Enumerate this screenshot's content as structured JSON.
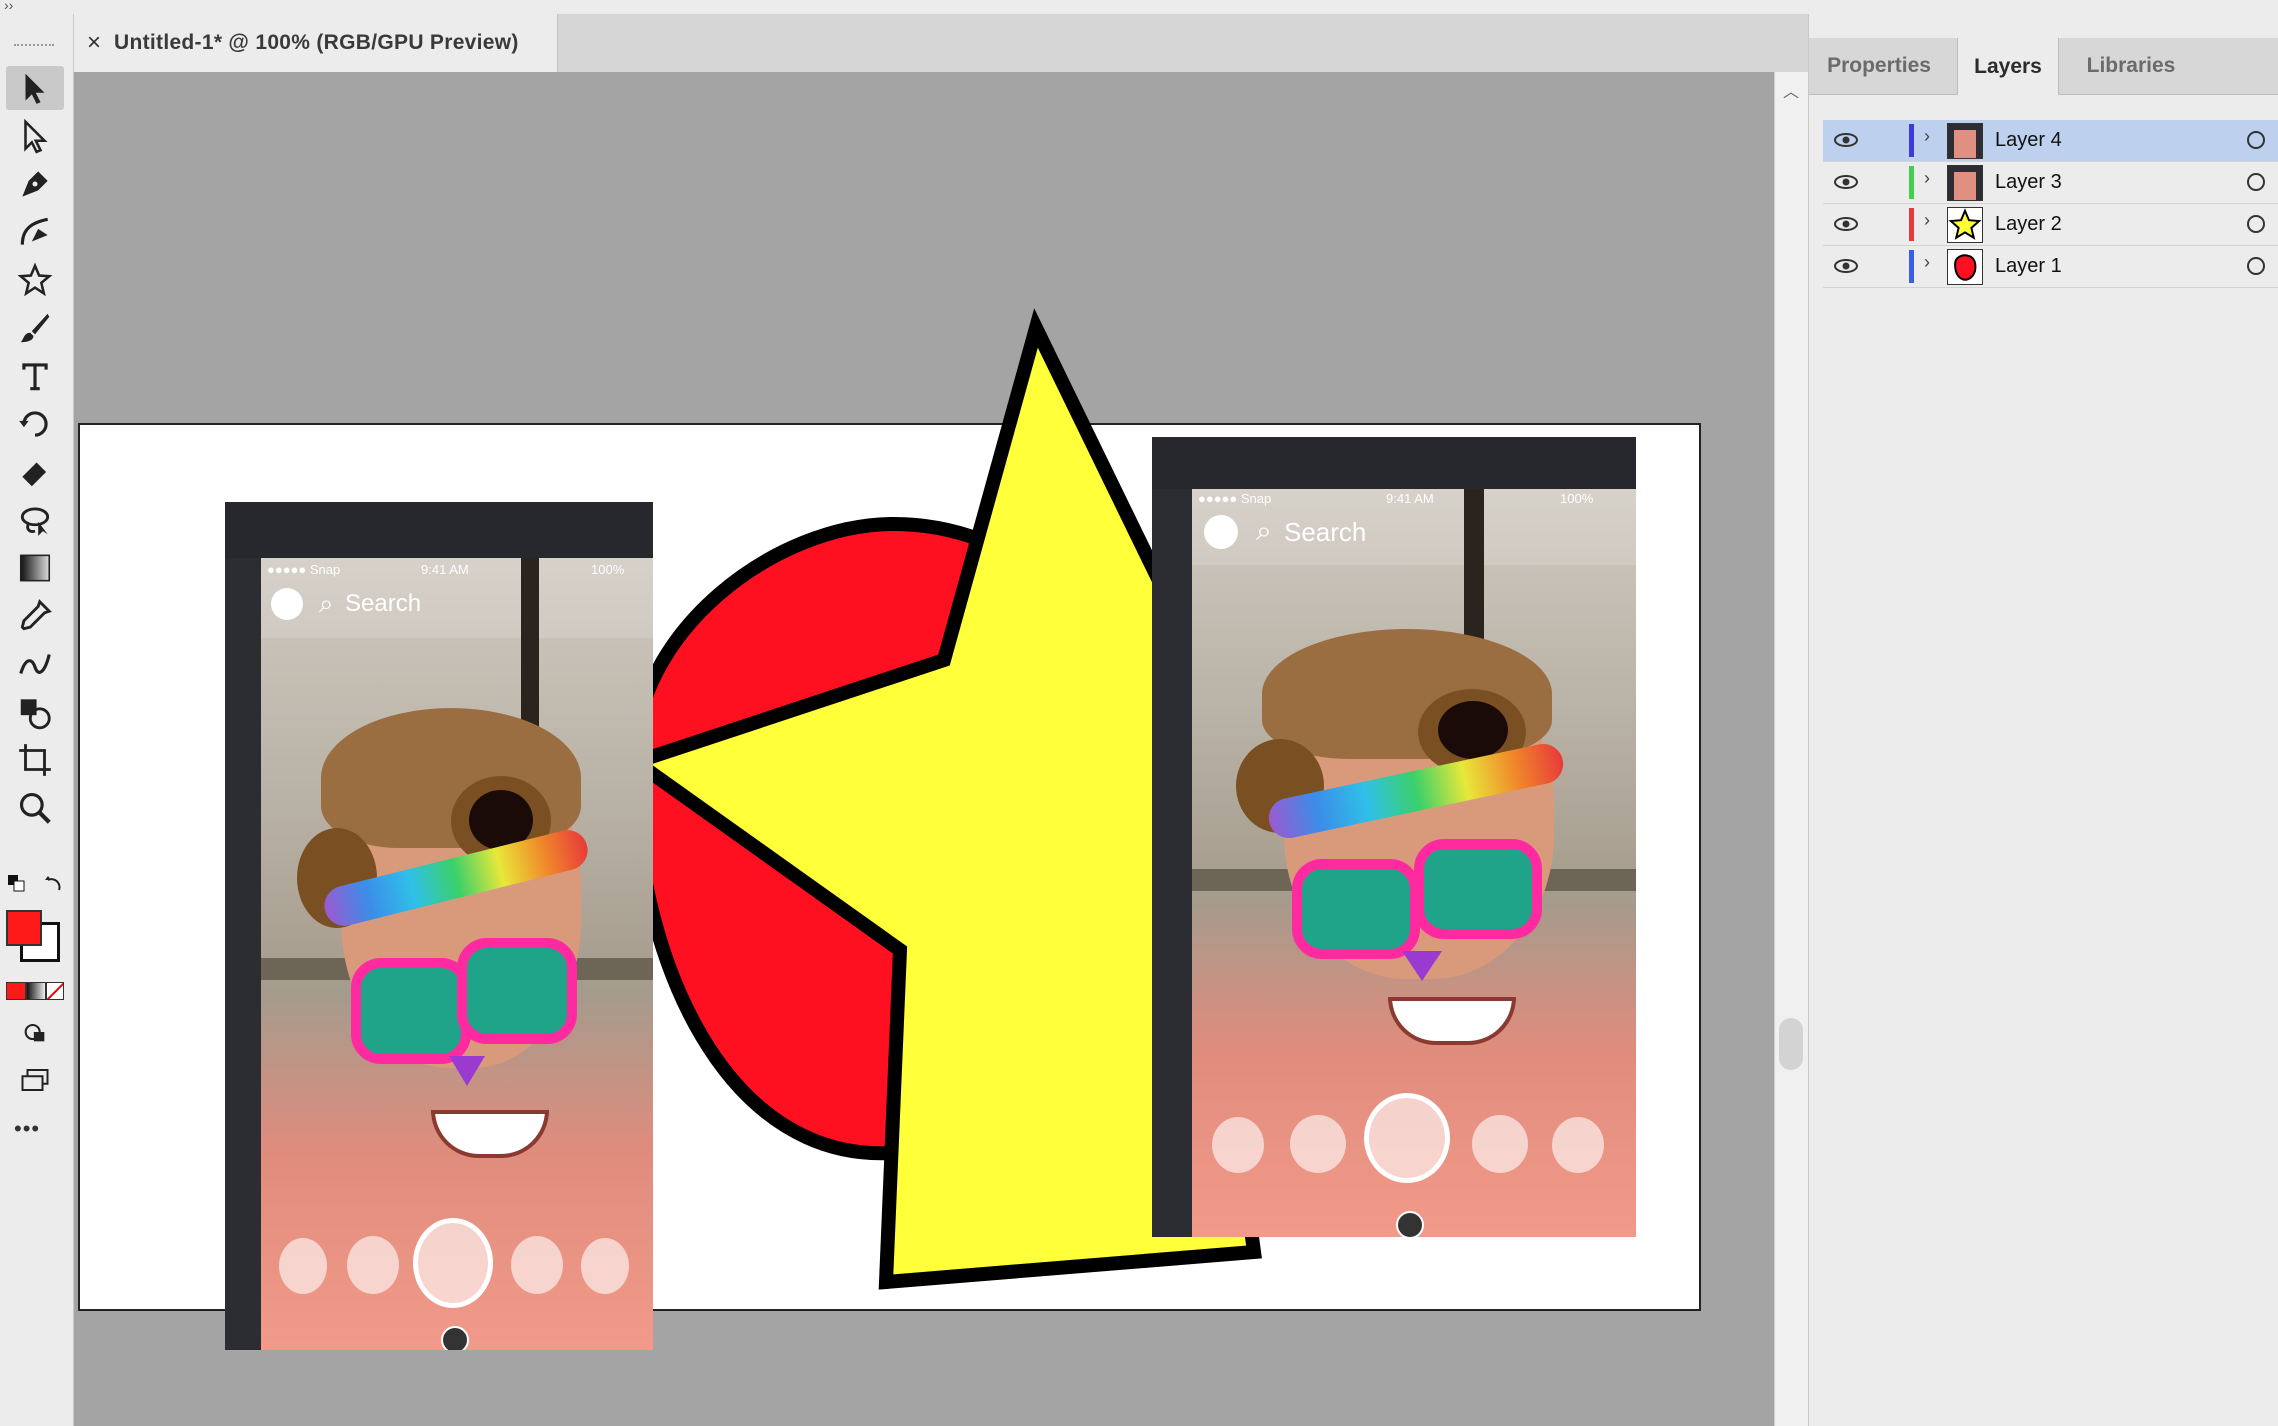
{
  "document": {
    "close_glyph": "×",
    "title": "Untitled-1* @ 100% (RGB/GPU Preview)"
  },
  "panel": {
    "tabs": [
      {
        "label": "Properties",
        "active": false
      },
      {
        "label": "Layers",
        "active": true
      },
      {
        "label": "Libraries",
        "active": false
      }
    ],
    "layers": [
      {
        "name": "Layer 4",
        "color": "#3b3bd9",
        "thumb": "phone-icon",
        "selected": true
      },
      {
        "name": "Layer 3",
        "color": "#3fd14a",
        "thumb": "phone-icon",
        "selected": false
      },
      {
        "name": "Layer 2",
        "color": "#e53a3a",
        "thumb": "star-icon",
        "selected": false
      },
      {
        "name": "Layer 1",
        "color": "#3a5ee5",
        "thumb": "red-blob-icon",
        "selected": false
      }
    ]
  },
  "toolbar": {
    "collapse_glyph": "››",
    "more_glyph": "•••",
    "fill_color": "#ff1a1a",
    "stroke_color": "#000000"
  },
  "artwork": {
    "shape_colors": {
      "red": "#ff1020",
      "yellow": "#ffff3a",
      "stroke": "#000000"
    },
    "phone_screens": [
      {
        "carrier": "●●●●● Snap",
        "time": "9:41 AM",
        "battery": "100%",
        "search_label": "Search"
      },
      {
        "carrier": "●●●●● Snap",
        "time": "9:41 AM",
        "battery": "100%",
        "search_label": "Search"
      }
    ]
  }
}
